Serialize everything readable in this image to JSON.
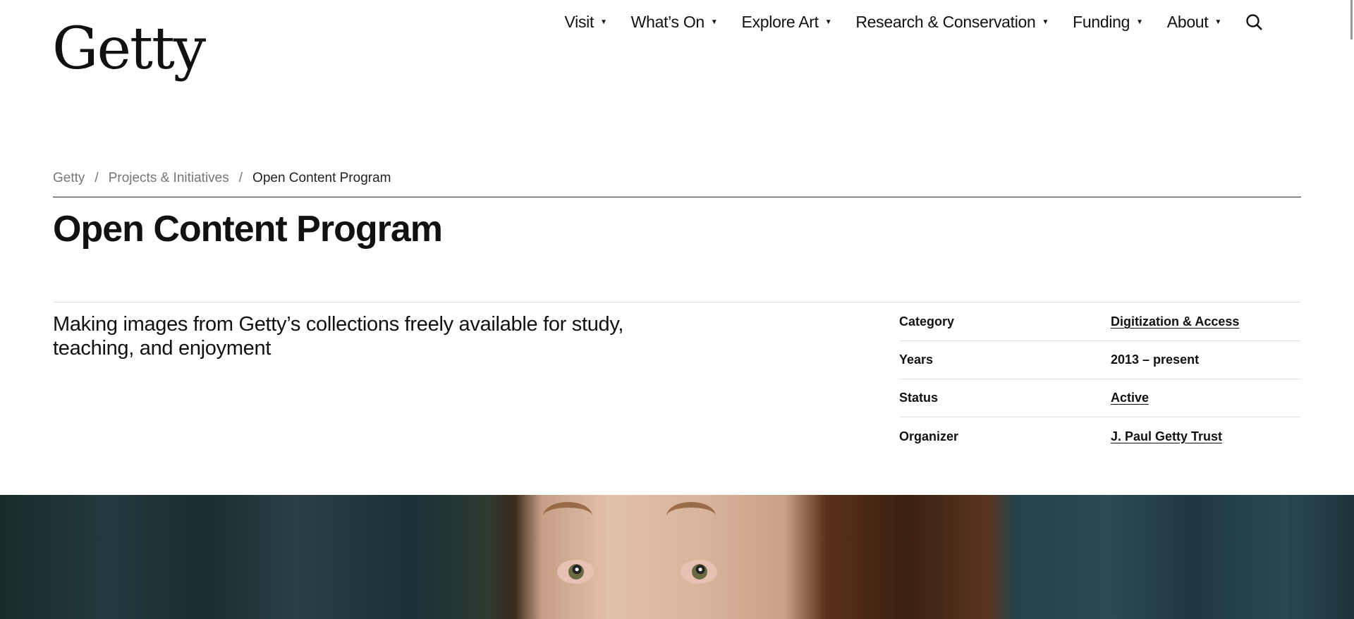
{
  "header": {
    "logo": "Getty",
    "nav": [
      "Visit",
      "What’s On",
      "Explore Art",
      "Research & Conservation",
      "Funding",
      "About"
    ],
    "search_icon": "search-icon"
  },
  "breadcrumb": [
    "Getty",
    "Projects & Initiatives",
    "Open Content Program"
  ],
  "page": {
    "title": "Open Content Program",
    "tagline": "Making images from Getty’s collections freely available for study, teaching, and enjoyment"
  },
  "meta": [
    {
      "label": "Category",
      "value": "Digitization & Access",
      "link": true
    },
    {
      "label": "Years",
      "value": "2013 – present",
      "link": false
    },
    {
      "label": "Status",
      "value": "Active",
      "link": true
    },
    {
      "label": "Organizer",
      "value": "J. Paul Getty Trust",
      "link": true
    }
  ]
}
